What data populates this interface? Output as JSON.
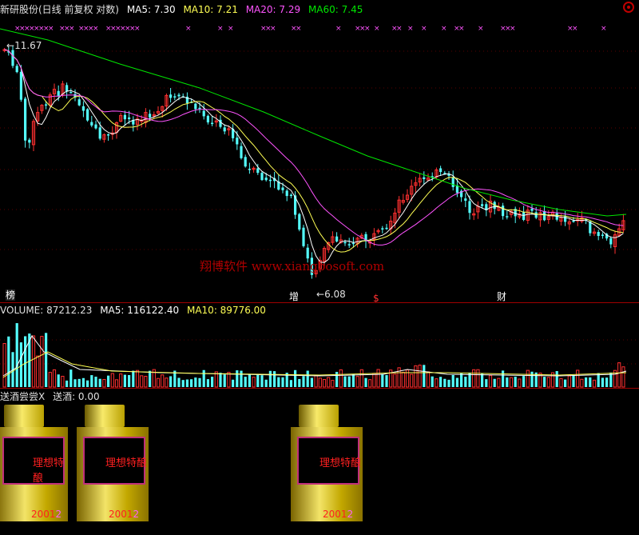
{
  "header": {
    "title": "新研股份(日线 前复权 对数)",
    "ma5": "MA5: 7.30",
    "ma10": "MA10: 7.21",
    "ma20": "MA20: 7.29",
    "ma60": "MA60: 7.45"
  },
  "colors": {
    "up": "#ff3030",
    "down": "#54fcfc",
    "ma5": "#ffffff",
    "ma10": "#ffff54",
    "ma20": "#ff54ff",
    "ma60": "#00e600",
    "marker": "#ff54ff"
  },
  "price_panel": {
    "high_label": "11.67",
    "low_label": "6.08",
    "watermark": "翔博软件 www.xiangbosoft.com",
    "events": [
      "榜",
      "增",
      "$",
      "财"
    ]
  },
  "volume_panel": {
    "volume": "VOLUME: 87212.23",
    "ma5": "MA5: 116122.40",
    "ma10": "MA10: 89776.00"
  },
  "indicator_panel": {
    "label1": "送酒尝尝X",
    "label2": "送酒: 0.00",
    "jars": [
      {
        "name": "理想特酿",
        "year": "2001",
        "suffix": "2"
      },
      {
        "name": "理想特酿",
        "year": "2001",
        "suffix": "2"
      },
      {
        "name": "理想特酿",
        "year": "2001",
        "suffix": "2"
      }
    ]
  },
  "chart_data": {
    "type": "line",
    "title": "新研股份(日线 前复权 对数)",
    "series": [
      {
        "name": "MA5",
        "values": [
          7.3
        ]
      },
      {
        "name": "MA10",
        "values": [
          7.21
        ]
      },
      {
        "name": "MA20",
        "values": [
          7.29
        ]
      },
      {
        "name": "MA60",
        "values": [
          7.45
        ]
      }
    ],
    "annotations": [
      "11.67",
      "6.08"
    ],
    "volume": {
      "value": 87212.23,
      "ma5": 116122.4,
      "ma10": 89776.0
    }
  }
}
